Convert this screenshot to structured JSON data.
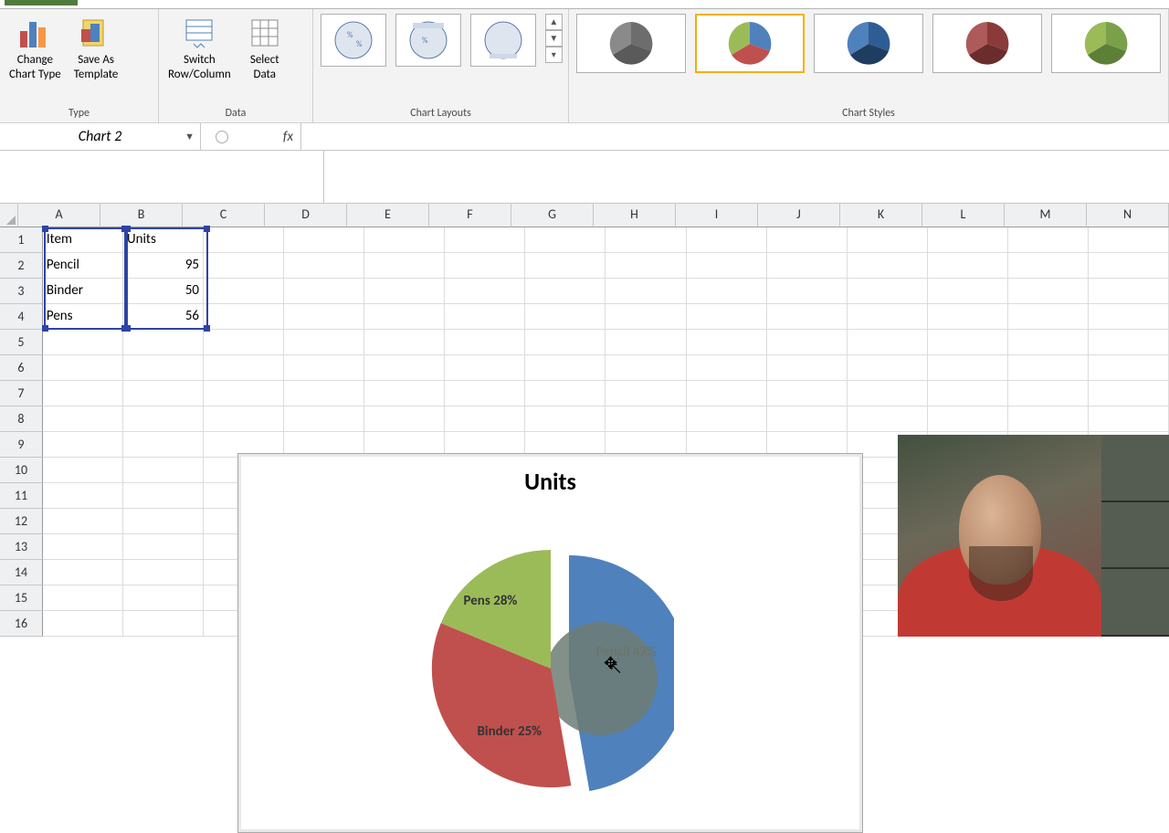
{
  "ribbon": {
    "groups": {
      "type": {
        "label": "Type",
        "change_chart": "Change\nChart Type",
        "save_as": "Save As\nTemplate"
      },
      "data": {
        "label": "Data",
        "switch": "Switch\nRow/Column",
        "select": "Select\nData"
      },
      "layouts": {
        "label": "Chart Layouts"
      },
      "styles": {
        "label": "Chart Styles"
      }
    }
  },
  "namebox": "Chart 2",
  "fx_label": "fx",
  "columns": [
    "A",
    "B",
    "C",
    "D",
    "E",
    "F",
    "G",
    "H",
    "I",
    "J",
    "K",
    "L",
    "M",
    "N"
  ],
  "rows_visible": 16,
  "cells": {
    "A1": "Item",
    "B1": "Units",
    "A2": "Pencil",
    "B2": "95",
    "A3": "Binder",
    "B3": "50",
    "A4": "Pens",
    "B4": "56"
  },
  "chart": {
    "title": "Units",
    "labels": {
      "pencil": "Pencil\n47%",
      "binder": "Binder\n25%",
      "pens": "Pens\n28%"
    }
  },
  "chart_data": {
    "type": "pie",
    "title": "Units",
    "categories": [
      "Pencil",
      "Binder",
      "Pens"
    ],
    "values": [
      95,
      50,
      56
    ],
    "percentages": [
      47,
      25,
      28
    ],
    "colors": {
      "Pencil": "#4f81bd",
      "Binder": "#c0504d",
      "Pens": "#9bbb59"
    },
    "exploded_slice": "Pencil"
  },
  "style_colors": [
    [
      "#6d6d6d",
      "#5a5a5a",
      "#8a8a8a"
    ],
    [
      "#4f81bd",
      "#c0504d",
      "#9bbb59"
    ],
    [
      "#2e5d94",
      "#1f3d61",
      "#4f81bd"
    ],
    [
      "#8b3a3a",
      "#6b2c2c",
      "#ad5a5a"
    ],
    [
      "#7aa14a",
      "#5d7f38",
      "#9bbb59"
    ]
  ]
}
